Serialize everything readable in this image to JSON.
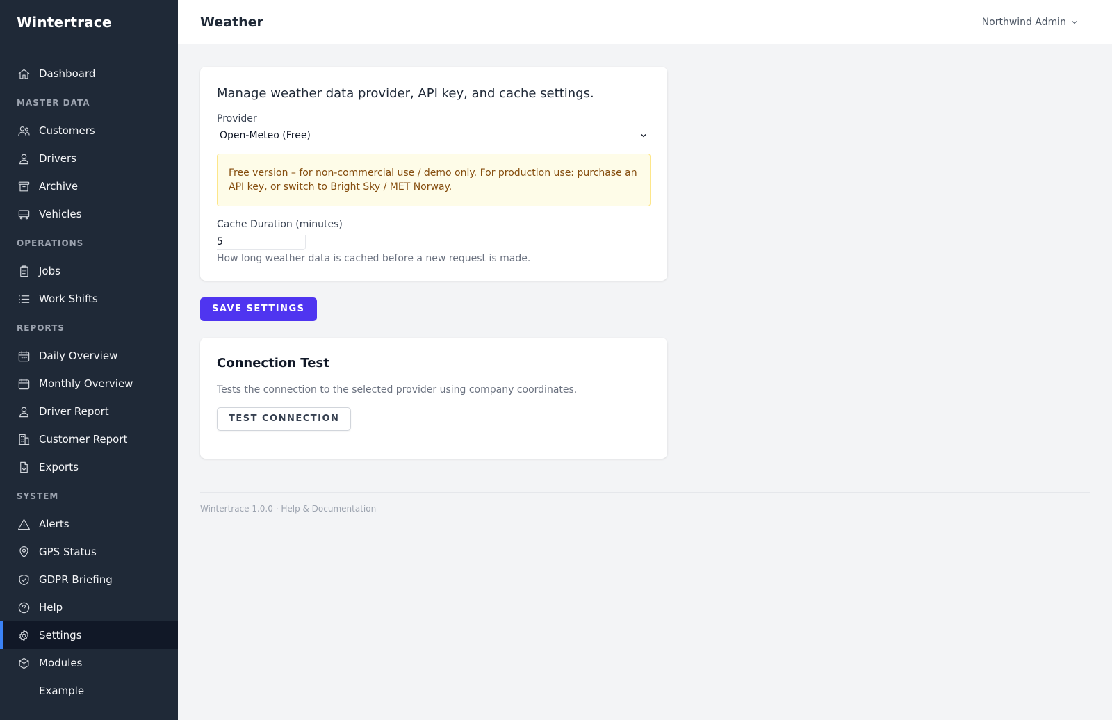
{
  "app": {
    "name": "Wintertrace"
  },
  "header": {
    "title": "Weather",
    "user": "Northwind Admin"
  },
  "sidebar": {
    "dashboard": {
      "label": "Dashboard",
      "icon": "home-icon"
    },
    "sections": {
      "master_data": "MASTER DATA",
      "operations": "OPERATIONS",
      "reports": "REPORTS",
      "system": "SYSTEM"
    },
    "items": {
      "customers": "Customers",
      "drivers": "Drivers",
      "archive": "Archive",
      "vehicles": "Vehicles",
      "jobs": "Jobs",
      "work_shifts": "Work Shifts",
      "daily_overview": "Daily Overview",
      "monthly_overview": "Monthly Overview",
      "driver_report": "Driver Report",
      "customer_report": "Customer Report",
      "exports": "Exports",
      "alerts": "Alerts",
      "gps_status": "GPS Status",
      "gdpr_briefing": "GDPR Briefing",
      "help": "Help",
      "settings": "Settings",
      "modules": "Modules",
      "example": "Example"
    },
    "active": "settings",
    "accent_color": "#3b82f6"
  },
  "settings_card": {
    "description": "Manage weather data provider, API key, and cache settings.",
    "provider_label": "Provider",
    "provider_value": "Open-Meteo (Free)",
    "notice": "Free version – for non-commercial use / demo only. For production use: purchase an API key, or switch to Bright Sky / MET Norway.",
    "cache_label": "Cache Duration (minutes)",
    "cache_value": "5",
    "cache_hint": "How long weather data is cached before a new request is made."
  },
  "save_button": "SAVE SETTINGS",
  "connection_card": {
    "title": "Connection Test",
    "description": "Tests the connection to the selected provider using company coordinates.",
    "button": "TEST CONNECTION"
  },
  "footer": {
    "text": "Wintertrace 1.0.0 · Help & Documentation"
  },
  "colors": {
    "primary_button": "#4f35f0",
    "sidebar_bg": "#1f2937",
    "notice_bg": "#fefce8",
    "notice_text": "#854d0e"
  }
}
